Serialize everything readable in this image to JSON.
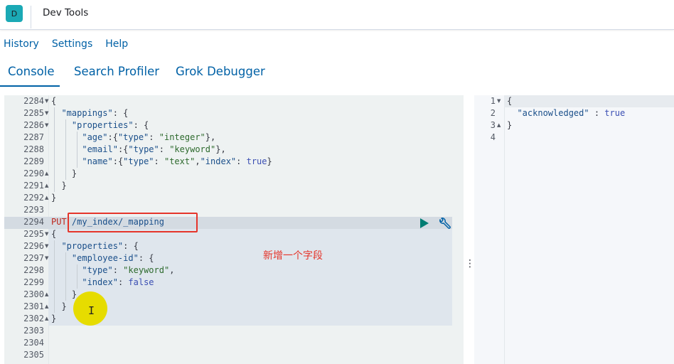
{
  "app": {
    "badge": "D",
    "title": "Dev Tools"
  },
  "menu": [
    "History",
    "Settings",
    "Help"
  ],
  "tabs": [
    "Console",
    "Search Profiler",
    "Grok Debugger"
  ],
  "left_editor": {
    "line_numbers": [
      "2284",
      "2285",
      "2286",
      "2287",
      "2288",
      "2289",
      "2290",
      "2291",
      "2292",
      "2293",
      "2294",
      "2295",
      "2296",
      "2297",
      "2298",
      "2299",
      "2300",
      "2301",
      "2302",
      "2303",
      "2304",
      "2305"
    ],
    "method": "PUT",
    "path": "/my_index/_mapping",
    "annotation": "新增一个字段"
  },
  "right_editor": {
    "line_numbers": [
      "1",
      "2",
      "3",
      "4"
    ],
    "response_key": "\"acknowledged\"",
    "response_value": "true"
  },
  "colors": {
    "accent": "#0061a6",
    "annotation": "#e5352b",
    "play": "#017d73",
    "cursor_highlight": "#e6dc00"
  },
  "icons": {
    "send": "play-icon",
    "settings": "wrench-icon",
    "resize": "vertical-dots-icon"
  }
}
